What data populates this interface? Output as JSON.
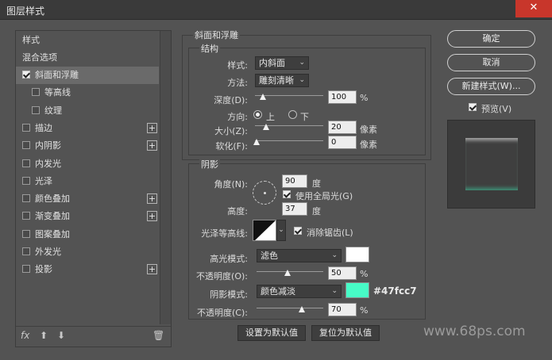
{
  "window": {
    "title": "图层样式",
    "close_glyph": "✕"
  },
  "left_panel": {
    "header": "样式",
    "blend": "混合选项",
    "items": [
      {
        "label": "斜面和浮雕",
        "checked": true,
        "plus": false,
        "sub": false
      },
      {
        "label": "等高线",
        "checked": false,
        "plus": false,
        "sub": true
      },
      {
        "label": "纹理",
        "checked": false,
        "plus": false,
        "sub": true
      },
      {
        "label": "描边",
        "checked": false,
        "plus": true,
        "sub": false
      },
      {
        "label": "内阴影",
        "checked": false,
        "plus": true,
        "sub": false
      },
      {
        "label": "内发光",
        "checked": false,
        "plus": false,
        "sub": false
      },
      {
        "label": "光泽",
        "checked": false,
        "plus": false,
        "sub": false
      },
      {
        "label": "颜色叠加",
        "checked": false,
        "plus": true,
        "sub": false
      },
      {
        "label": "渐变叠加",
        "checked": false,
        "plus": true,
        "sub": false
      },
      {
        "label": "图案叠加",
        "checked": false,
        "plus": false,
        "sub": false
      },
      {
        "label": "外发光",
        "checked": false,
        "plus": false,
        "sub": false
      },
      {
        "label": "投影",
        "checked": false,
        "plus": true,
        "sub": false
      }
    ],
    "plus_glyph": "+",
    "footer": {
      "fx": "fx",
      "up": "⬆",
      "down": "⬇",
      "trash": "🗑"
    }
  },
  "bevel": {
    "section_title": "斜面和浮雕",
    "structure_title": "结构",
    "style_label": "样式:",
    "style_value": "内斜面",
    "technique_label": "方法:",
    "technique_value": "雕刻清晰",
    "depth_label": "深度(D):",
    "depth_value": "100",
    "depth_unit": "%",
    "direction_label": "方向:",
    "dir_up": "上",
    "dir_down": "下",
    "size_label": "大小(Z):",
    "size_value": "20",
    "size_unit": "像素",
    "soften_label": "软化(F):",
    "soften_value": "0",
    "soften_unit": "像素"
  },
  "shading": {
    "title": "阴影",
    "angle_label": "角度(N):",
    "angle_value": "90",
    "angle_unit": "度",
    "global_light": "使用全局光(G)",
    "altitude_label": "高度:",
    "altitude_value": "37",
    "altitude_unit": "度",
    "gloss_label": "光泽等高线:",
    "antialias": "消除锯齿(L)",
    "highlight_label": "高光模式:",
    "highlight_value": "滤色",
    "highlight_opacity_label": "不透明度(O):",
    "highlight_opacity_value": "50",
    "highlight_opacity_unit": "%",
    "shadow_label": "阴影模式:",
    "shadow_value": "颜色减淡",
    "shadow_opacity_label": "不透明度(C):",
    "shadow_opacity_value": "70",
    "shadow_opacity_unit": "%",
    "shadow_hex": "#47fcc7",
    "highlight_color": "#ffffff",
    "shadow_color": "#47fcc7"
  },
  "buttons": {
    "set_default": "设置为默认值",
    "reset_default": "复位为默认值",
    "ok": "确定",
    "cancel": "取消",
    "new_style": "新建样式(W)...",
    "preview": "预览(V)"
  },
  "watermark": "www.68ps.com",
  "dropdown_glyph": "⌄"
}
